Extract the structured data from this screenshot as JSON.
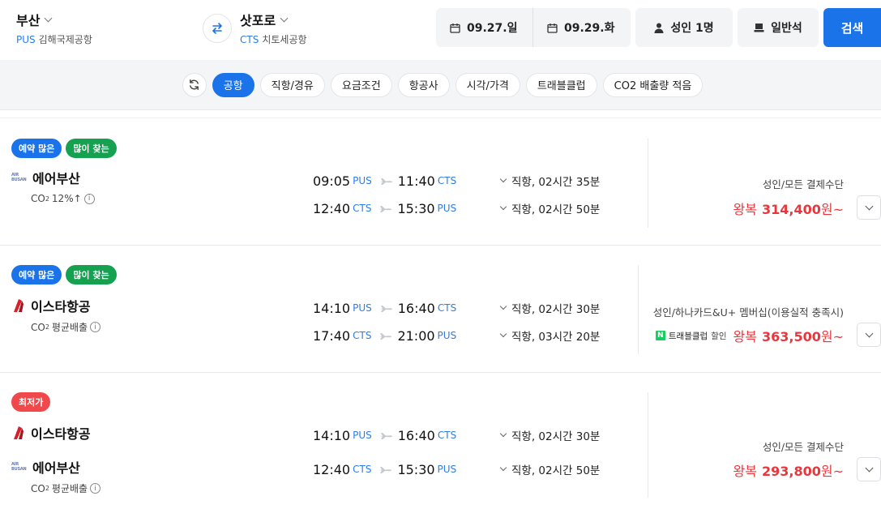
{
  "header": {
    "origin": {
      "city": "부산",
      "code": "PUS",
      "airport": "김해국제공항"
    },
    "destination": {
      "city": "삿포로",
      "code": "CTS",
      "airport": "치토세공항"
    },
    "depart_date": "09.27.일",
    "return_date": "09.29.화",
    "passengers": "성인 1명",
    "cabin": "일반석",
    "search_label": "검색"
  },
  "filters": [
    "공항",
    "직항/경유",
    "요금조건",
    "항공사",
    "시각/가격",
    "트래블클럽",
    "CO2 배출량 적음"
  ],
  "active_filter": "공항",
  "results": [
    {
      "badges": [
        {
          "label": "예약 많은",
          "color": "blue"
        },
        {
          "label": "많이 찾는",
          "color": "green"
        }
      ],
      "airlines": [
        {
          "name": "에어부산",
          "logo": "airbusan-logo",
          "logo_text": "AIR BUSAN"
        }
      ],
      "co2_label": "CO",
      "co2_sub": "2",
      "co2_value": "12%↑",
      "legs": [
        {
          "dep_time": "09:05",
          "dep_code": "PUS",
          "arr_time": "11:40",
          "arr_code": "CTS",
          "info": "직항, 02시간 35분"
        },
        {
          "dep_time": "12:40",
          "dep_code": "CTS",
          "arr_time": "15:30",
          "arr_code": "PUS",
          "info": "직항, 02시간 50분"
        }
      ],
      "price_condition": "성인/모든 결제수단",
      "price_prefix": "왕복",
      "price_amount": "314,400",
      "price_suffix": "원~"
    },
    {
      "badges": [
        {
          "label": "예약 많은",
          "color": "blue"
        },
        {
          "label": "많이 찾는",
          "color": "green"
        }
      ],
      "airlines": [
        {
          "name": "이스타항공",
          "logo": "eastarjet-logo"
        }
      ],
      "co2_label": "CO",
      "co2_sub": "2",
      "co2_value": "평균배출",
      "legs": [
        {
          "dep_time": "14:10",
          "dep_code": "PUS",
          "arr_time": "16:40",
          "arr_code": "CTS",
          "info": "직항, 02시간 30분"
        },
        {
          "dep_time": "17:40",
          "dep_code": "CTS",
          "arr_time": "21:00",
          "arr_code": "PUS",
          "info": "직항, 03시간 20분"
        }
      ],
      "price_condition": "성인/하나카드&U+ 멤버십(이용실적 충족시)",
      "travel_club": {
        "badge": "N",
        "label": "트래블클럽",
        "discount": "할인"
      },
      "price_prefix": "왕복",
      "price_amount": "363,500",
      "price_suffix": "원~"
    },
    {
      "badges": [
        {
          "label": "최저가",
          "color": "red"
        }
      ],
      "airlines": [
        {
          "name": "이스타항공",
          "logo": "eastarjet-logo"
        },
        {
          "name": "에어부산",
          "logo": "airbusan-logo",
          "logo_text": "AIR BUSAN"
        }
      ],
      "co2_label": "CO",
      "co2_sub": "2",
      "co2_value": "평균배출",
      "legs": [
        {
          "dep_time": "14:10",
          "dep_code": "PUS",
          "arr_time": "16:40",
          "arr_code": "CTS",
          "info": "직항, 02시간 30분"
        },
        {
          "dep_time": "12:40",
          "dep_code": "CTS",
          "arr_time": "15:30",
          "arr_code": "PUS",
          "info": "직항, 02시간 50분"
        }
      ],
      "price_condition": "성인/모든 결제수단",
      "price_prefix": "왕복",
      "price_amount": "293,800",
      "price_suffix": "원~"
    }
  ],
  "colors": {
    "accent": "#1a73e8",
    "price": "#e8373c",
    "green_badge": "#15a150",
    "red_badge": "#f0484b",
    "airport_code": "#2b7de9"
  }
}
